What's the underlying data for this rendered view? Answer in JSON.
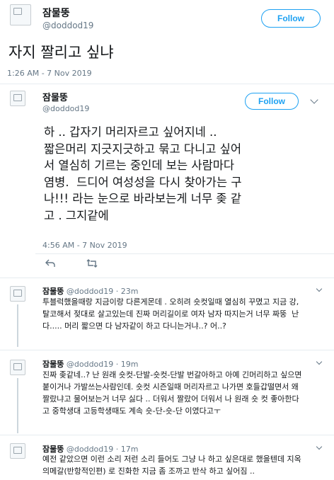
{
  "original_tweet": {
    "display_name": "잠물뚱",
    "handle": "@doddod19",
    "follow_label": "Follow",
    "text": "자지 짤리고 싶냐",
    "timestamp": "1:26 AM - 7 Nov 2019"
  },
  "quoted_tweet": {
    "display_name": "잠물뚱",
    "handle": "@doddod19",
    "follow_label": "Follow",
    "text": "하 .. 갑자기 머리자르고 싶어지네 ..\n짧은머리 지긋지긋하고 묶고 다니고 싶어\n서 열심히 기르는 중인데 보는 사람마다\n염병.  드디어 여성성을 다시 찾아가는 구\n나!!! 라는 눈으로 바라보는게 너무 좆 같\n고 . 그지같에",
    "timestamp": "4:56 AM - 7 Nov 2019",
    "reply_icon": "reply-icon",
    "retweet_icon": "retweet-icon"
  },
  "replies": [
    {
      "display_name": "잠물뚱",
      "handle": "@doddod19",
      "age": "· 23m",
      "text": "투블럭했을때랑 지금이랑 다른게몬데 . 오히려 숏컷일때 열심히 꾸몄고 지금 강,\n탈코해서 젖대로 살고있는데 진짜 머리길이로 여자 남자 따지는거 너무 짜뚱  난\n다..... 머리 짧으면 다 남자같이 하고 다니는거냐..? 어..?"
    },
    {
      "display_name": "잠물뚱",
      "handle": "@doddod19",
      "age": "· 19m",
      "text": "진짜 좆같네..? 난 원래 숏컷-단발-숏컷-단발 번갈아하고 아예 긴머리하고 싶으면\n붙이거나 가발쓰는사람인데. 숏컷 시즌일때 머리자르고 나가면 호들갑떨면서 왜\n짤랐냐고 물어보는거 너무 싫다 .. 더워서 짤랐어 더워서 나 원래 숏 컷 좋아한다\n고 중학생대 고등학생때도 계속 숏-단-숏-단 이였다고ㅜ"
    },
    {
      "display_name": "잠물뚱",
      "handle": "@doddod19",
      "age": "· 17m",
      "text": "예전 같았으면 이런 소리 저런 소리 들어도 그냥 나 하고 싶은대로 했을텐데 지옥\n의메갈(반항적인편) 로 진화한 지금 좀 조까고 반삭 하고 싶어짐 .."
    }
  ]
}
